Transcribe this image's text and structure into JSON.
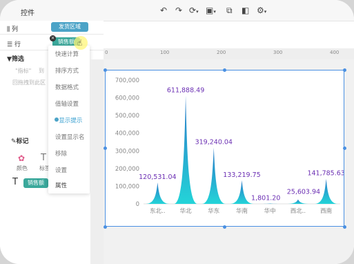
{
  "header": {
    "title": "控件",
    "icons": [
      "undo-icon",
      "redo-icon",
      "refresh-icon",
      "save-icon",
      "copy-icon",
      "adjust-icon",
      "settings-icon"
    ]
  },
  "fields": {
    "column_label": "列",
    "column_pill": "发货区域",
    "row_label": "行",
    "row_pill": "销售额",
    "filter_label": "筛选",
    "filter_hint_left": "\"指标\"",
    "filter_hint_right": "到",
    "filter_hint2": "回拖拽到此区",
    "mark_label": "标记",
    "color_label": "颜色",
    "text_label": "标签",
    "mark_pill": "销售额",
    "mark_pill2": "属性"
  },
  "menu": {
    "items": [
      "快速计算",
      "排序方式",
      "数据格式",
      "值轴设置",
      "显示提示",
      "设置显示名",
      "移除",
      "设置"
    ],
    "selected_index": 4
  },
  "ruler": {
    "marks": [
      "0",
      "100",
      "200",
      "300",
      "400"
    ]
  },
  "colors": {
    "accent": "#4a90e2",
    "bar_top": "#2b79c8",
    "bar_bottom": "#24d4d8",
    "label": "#6b2fb3",
    "pill_blue": "#4ba3c7",
    "pill_teal": "#3aa89b"
  },
  "chart_data": {
    "type": "area",
    "title": "",
    "xlabel": "",
    "ylabel": "",
    "categories": [
      "东北",
      "华北",
      "华东",
      "华南",
      "华中",
      "西北",
      "西南"
    ],
    "category_labels_display": [
      "东北..",
      "华北",
      "华东",
      "华南",
      "华中",
      "西北..",
      "西南"
    ],
    "values": [
      120531.04,
      611888.49,
      319240.04,
      133219.75,
      1801.2,
      25603.94,
      141785.63
    ],
    "value_labels": [
      "120,531.04",
      "611,888.49",
      "319,240.04",
      "133,219.75",
      "1,801.20",
      "25,603.94",
      "141,785.63"
    ],
    "ylim": [
      0,
      700000
    ],
    "yticks": [
      0,
      100000,
      200000,
      300000,
      400000,
      500000,
      600000,
      700000
    ],
    "ytick_labels": [
      "0",
      "100,000",
      "200,000",
      "300,000",
      "400,000",
      "500,000",
      "600,000",
      "700,000"
    ],
    "grid": false,
    "legend": "none"
  }
}
